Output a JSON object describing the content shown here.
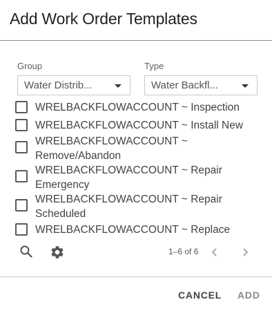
{
  "dialog": {
    "title": "Add Work Order Templates"
  },
  "filters": {
    "group": {
      "label": "Group",
      "value": "Water Distrib..."
    },
    "type": {
      "label": "Type",
      "value": "Water Backfl..."
    }
  },
  "items": [
    {
      "label": "WRELBACKFLOWACCOUNT ~ Inspection",
      "checked": false
    },
    {
      "label": "WRELBACKFLOWACCOUNT ~ Install New",
      "checked": false
    },
    {
      "label": "WRELBACKFLOWACCOUNT ~ Remove/Abandon",
      "checked": false
    },
    {
      "label": "WRELBACKFLOWACCOUNT ~ Repair Emergency",
      "checked": false
    },
    {
      "label": "WRELBACKFLOWACCOUNT ~ Repair Scheduled",
      "checked": false
    },
    {
      "label": "WRELBACKFLOWACCOUNT ~ Replace",
      "checked": false
    }
  ],
  "toolbar": {
    "search_icon": "search-icon",
    "settings_icon": "gear-icon"
  },
  "pagination": {
    "range_text": "1–6 of 6",
    "prev_icon": "chevron-left-icon",
    "next_icon": "chevron-right-icon"
  },
  "footer": {
    "cancel_label": "CANCEL",
    "add_label": "ADD"
  },
  "colors": {
    "cancel_text": "#424242",
    "add_text_disabled": "#8a8a8a",
    "divider": "#8a8a8a"
  }
}
